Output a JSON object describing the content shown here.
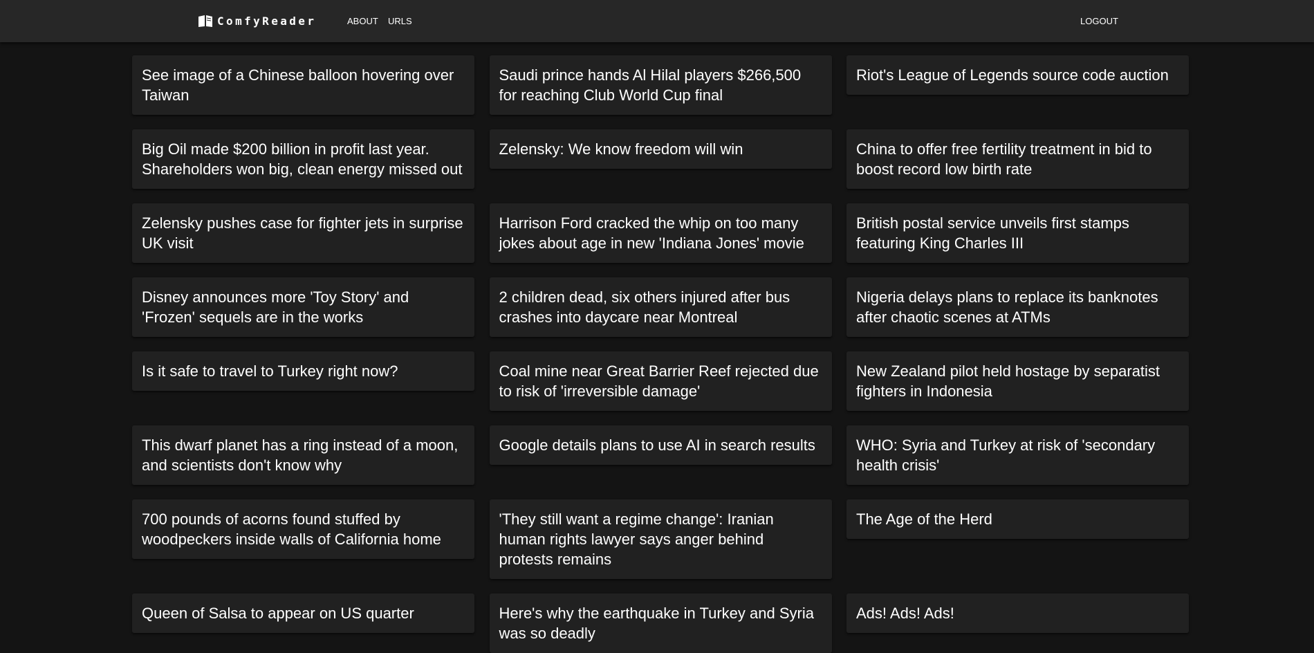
{
  "nav": {
    "brand": "ComfyReader",
    "about": "ABOUT",
    "urls": "URLS",
    "logout": "LOGOUT"
  },
  "articles": [
    {
      "title": "See image of a Chinese balloon hovering over Taiwan"
    },
    {
      "title": "Saudi prince hands Al Hilal players $266,500 for reaching Club World Cup final"
    },
    {
      "title": "Riot's League of Legends source code auction"
    },
    {
      "title": "Big Oil made $200 billion in profit last year. Shareholders won big, clean energy missed out"
    },
    {
      "title": "Zelensky: We know freedom will win"
    },
    {
      "title": "China to offer free fertility treatment in bid to boost record low birth rate"
    },
    {
      "title": "Zelensky pushes case for fighter jets in surprise UK visit"
    },
    {
      "title": "Harrison Ford cracked the whip on too many jokes about age in new 'Indiana Jones' movie"
    },
    {
      "title": "British postal service unveils first stamps featuring King Charles III"
    },
    {
      "title": "Disney announces more 'Toy Story' and 'Frozen' sequels are in the works"
    },
    {
      "title": "2 children dead, six others injured after bus crashes into daycare near Montreal"
    },
    {
      "title": "Nigeria delays plans to replace its banknotes after chaotic scenes at ATMs"
    },
    {
      "title": "Is it safe to travel to Turkey right now?"
    },
    {
      "title": "Coal mine near Great Barrier Reef rejected due to risk of 'irreversible damage'"
    },
    {
      "title": "New Zealand pilot held hostage by separatist fighters in Indonesia"
    },
    {
      "title": "This dwarf planet has a ring instead of a moon, and scientists don't know why"
    },
    {
      "title": "Google details plans to use AI in search results"
    },
    {
      "title": "WHO: Syria and Turkey at risk of 'secondary health crisis'"
    },
    {
      "title": "700 pounds of acorns found stuffed by woodpeckers inside walls of California home"
    },
    {
      "title": "'They still want a regime change': Iranian human rights lawyer says anger behind protests remains"
    },
    {
      "title": "The Age of the Herd"
    },
    {
      "title": "Queen of Salsa to appear on US quarter"
    },
    {
      "title": "Here's why the earthquake in Turkey and Syria was so deadly"
    },
    {
      "title": "Ads! Ads! Ads!"
    }
  ]
}
